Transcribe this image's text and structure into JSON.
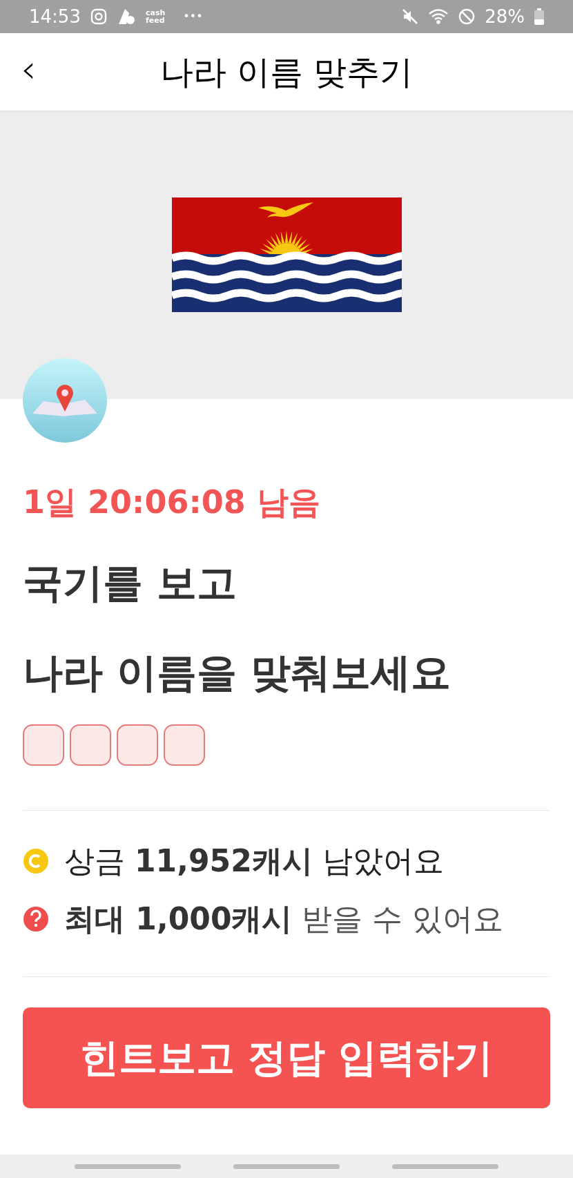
{
  "status_bar": {
    "time": "14:53",
    "app_label": [
      "cash",
      "feed"
    ],
    "more": "•••",
    "battery": "28%"
  },
  "header": {
    "back": "‹",
    "title": "나라 이름 맞추기"
  },
  "quiz": {
    "countdown": "1일 20:06:08 남음",
    "heading": [
      "국기를 보고",
      "나라 이름을 맞춰보세요"
    ],
    "answer_slots": [
      {
        "filled": false
      },
      {
        "filled": false
      },
      {
        "filled": false
      },
      {
        "filled": false
      }
    ]
  },
  "info": [
    {
      "kind": "coin",
      "text": "상금 **11,952캐시** 남았어요"
    },
    {
      "kind": "help",
      "text": "**최대 1,000캐시** 받을 수 있어요"
    }
  ],
  "button": "힌트보고 정답 입력하기"
}
